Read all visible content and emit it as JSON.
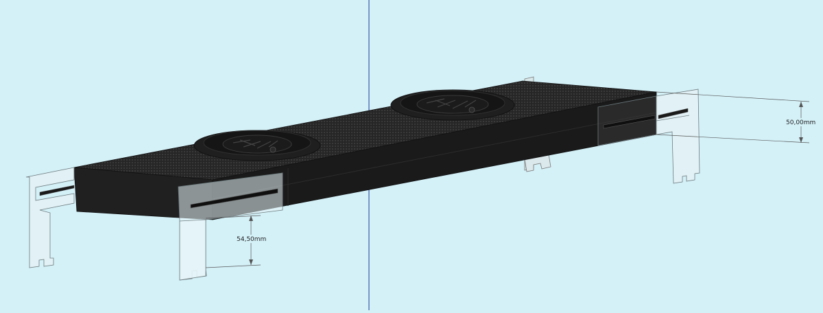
{
  "scene": {
    "background_color": "#d4f1f8",
    "axis_line_color": "#3a5aa8",
    "body_color": "#1c1c1c",
    "bracket_color": "#e6f4f7",
    "dimension_line_color": "#555555"
  },
  "dimensions": {
    "height_label": "50,00mm",
    "depth_label": "54,50mm"
  },
  "icons": {
    "fan": "fan-icon"
  }
}
